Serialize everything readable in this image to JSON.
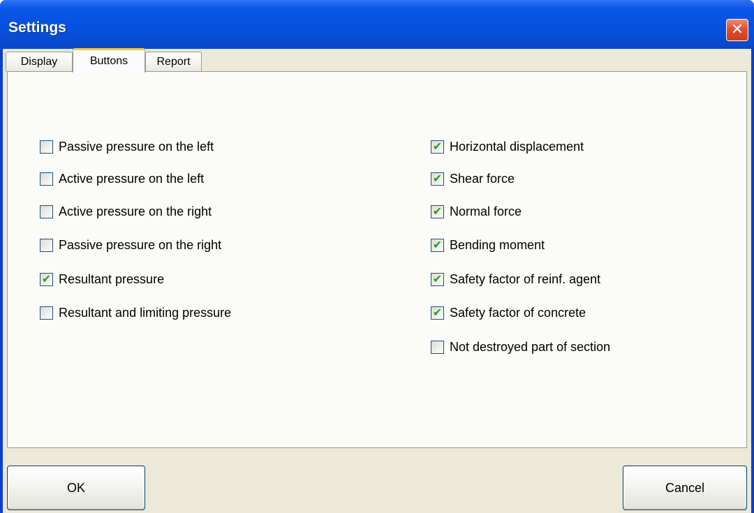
{
  "window": {
    "title": "Settings",
    "close_icon": "close-icon"
  },
  "tabs": [
    {
      "label": "Display",
      "active": false
    },
    {
      "label": "Buttons",
      "active": true
    },
    {
      "label": "Report",
      "active": false
    }
  ],
  "left_options": [
    {
      "label": "Passive pressure on the left",
      "checked": false
    },
    {
      "label": "Active pressure on the left",
      "checked": false
    },
    {
      "label": "Active pressure on the right",
      "checked": false
    },
    {
      "label": "Passive pressure on the right",
      "checked": false
    },
    {
      "label": "Resultant pressure",
      "checked": true
    },
    {
      "label": "Resultant and limiting pressure",
      "checked": false
    }
  ],
  "right_options": [
    {
      "label": "Horizontal displacement",
      "checked": true
    },
    {
      "label": "Shear force",
      "checked": true
    },
    {
      "label": "Normal force",
      "checked": true
    },
    {
      "label": "Bending moment",
      "checked": true
    },
    {
      "label": "Safety factor of reinf. agent",
      "checked": true
    },
    {
      "label": "Safety factor of concrete",
      "checked": true
    },
    {
      "label": "Not destroyed part of section",
      "checked": false
    }
  ],
  "buttons": {
    "ok_label": "OK",
    "cancel_label": "Cancel"
  },
  "colors": {
    "titlebar": "#0650dc",
    "check": "#21a121",
    "active_tab_accent": "#ffc73c"
  }
}
